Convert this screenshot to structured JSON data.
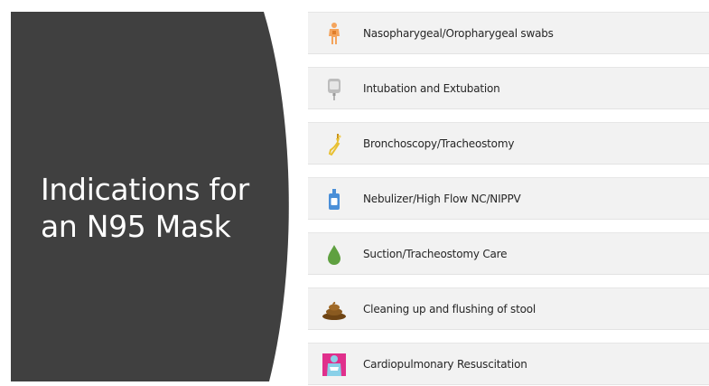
{
  "slide": {
    "title_line1": "Indications for",
    "title_line2": "an N95 Mask"
  },
  "items": [
    {
      "label": "Nasopharygeal/Oropharygeal  swabs",
      "icon": "person-figure-icon"
    },
    {
      "label": "Intubation and Extubation",
      "icon": "iv-bag-icon"
    },
    {
      "label": "Bronchoscopy/Tracheostomy",
      "icon": "scope-icon"
    },
    {
      "label": "Nebulizer/High Flow NC/NIPPV",
      "icon": "nebulizer-bottle-icon"
    },
    {
      "label": "Suction/Tracheostomy Care",
      "icon": "droplet-icon"
    },
    {
      "label": "Cleaning up and flushing of stool",
      "icon": "stool-icon"
    },
    {
      "label": "Cardiopulmonary Resuscitation",
      "icon": "cpr-person-icon"
    }
  ],
  "colors": {
    "panel": "#404040",
    "row_bg": "#f2f2f2",
    "text": "#262626",
    "orange": "#f4a45c",
    "gray": "#9a9a9a",
    "yellow": "#e8c033",
    "blue": "#4a8fd8",
    "green": "#5fa040",
    "brown": "#8a5a20",
    "pink": "#e0308c"
  }
}
